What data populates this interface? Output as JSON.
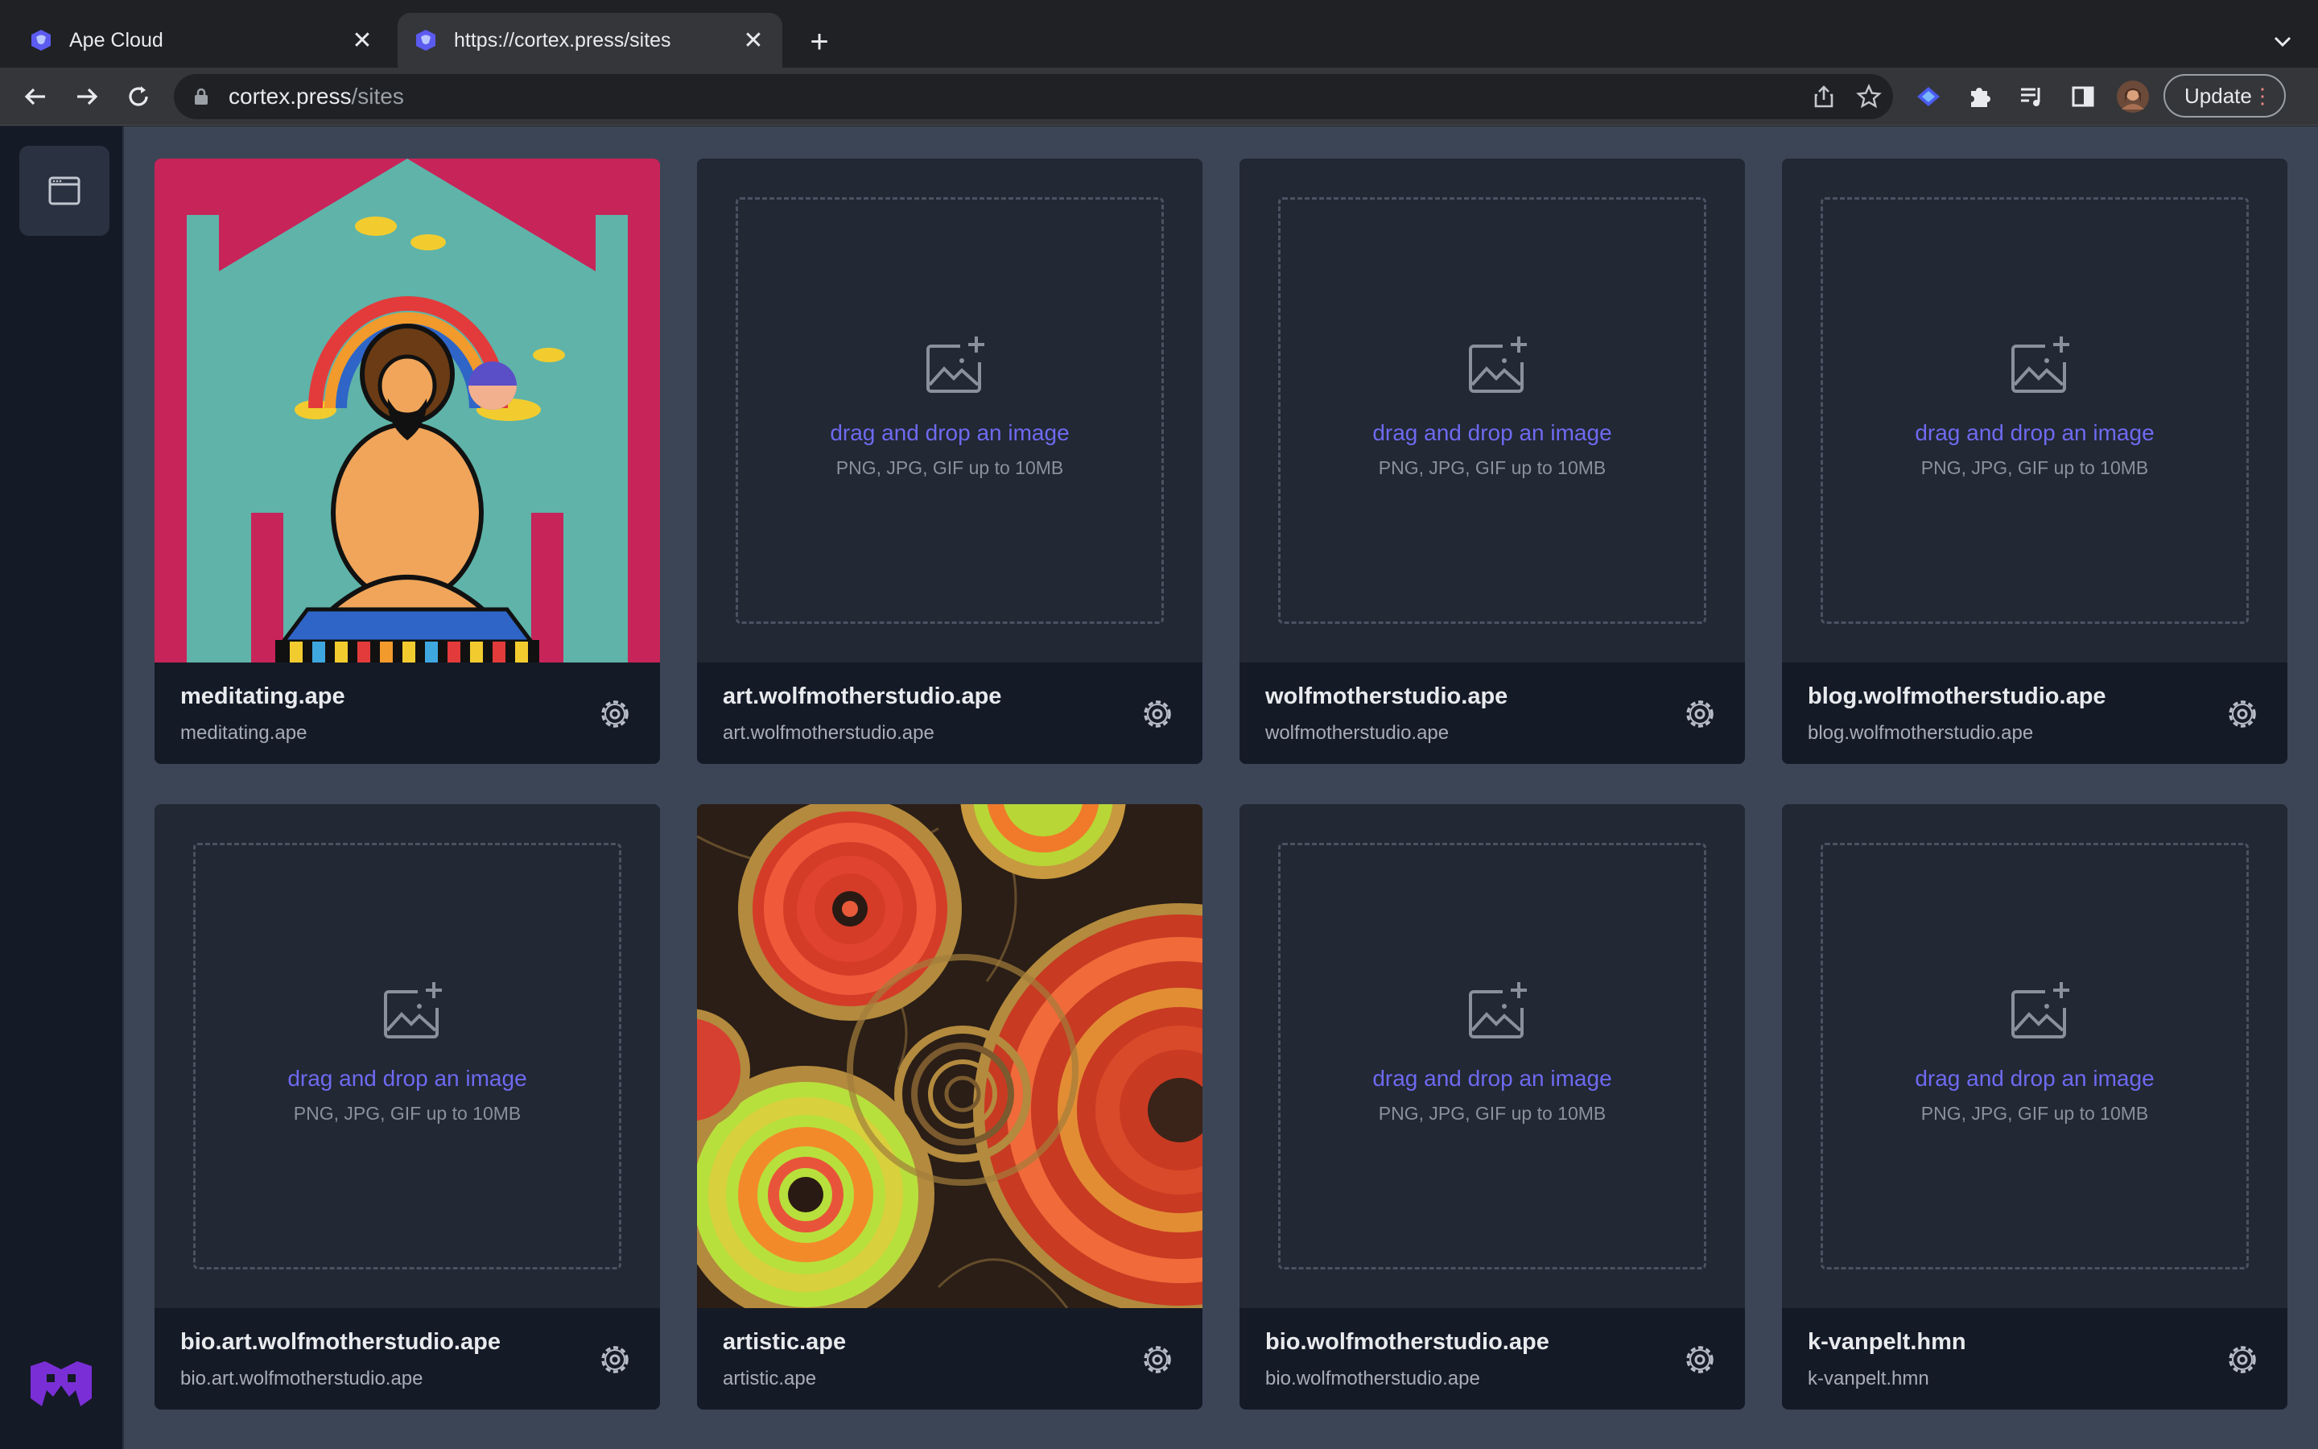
{
  "browser": {
    "tabs": [
      {
        "title": "Ape Cloud",
        "active": false
      },
      {
        "title": "https://cortex.press/sites",
        "active": true
      }
    ],
    "url_host": "cortex.press",
    "url_path": "/sites",
    "update_label": "Update"
  },
  "sidebar": {
    "items": [
      {
        "icon": "browser-window-icon"
      }
    ],
    "logo": "ape-logo"
  },
  "upload": {
    "prompt": "drag and drop an image",
    "hint": "PNG, JPG, GIF up to 10MB"
  },
  "sites": [
    {
      "name": "meditating.ape",
      "domain": "meditating.ape",
      "image": "meditating-ape-illustration"
    },
    {
      "name": "art.wolfmotherstudio.ape",
      "domain": "art.wolfmotherstudio.ape",
      "image": null
    },
    {
      "name": "wolfmotherstudio.ape",
      "domain": "wolfmotherstudio.ape",
      "image": null
    },
    {
      "name": "blog.wolfmotherstudio.ape",
      "domain": "blog.wolfmotherstudio.ape",
      "image": null
    },
    {
      "name": "bio.art.wolfmotherstudio.ape",
      "domain": "bio.art.wolfmotherstudio.ape",
      "image": null
    },
    {
      "name": "artistic.ape",
      "domain": "artistic.ape",
      "image": "abstract-circles-painting"
    },
    {
      "name": "bio.wolfmotherstudio.ape",
      "domain": "bio.wolfmotherstudio.ape",
      "image": null
    },
    {
      "name": "k-vanpelt.hmn",
      "domain": "k-vanpelt.hmn",
      "image": null
    }
  ],
  "colors": {
    "app_bg": "#3c4556",
    "card_bg": "#1f2533",
    "footer_bg": "#151a27",
    "accent": "#6e6af0"
  }
}
